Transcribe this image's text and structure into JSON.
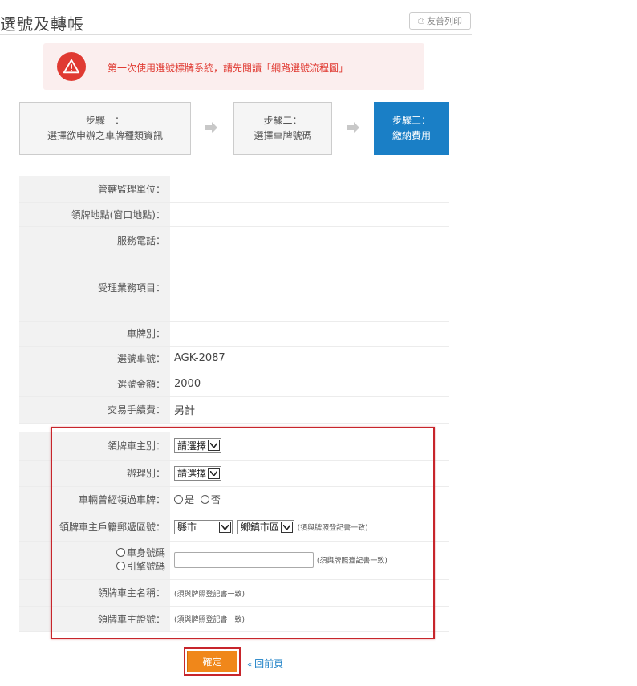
{
  "header": {
    "title": "選號及轉帳",
    "print_label": "友善列印"
  },
  "notice": {
    "text": "第一次使用選號標牌系統，請先閱讀「網路選號流程圖」"
  },
  "steps": [
    {
      "line1": "步驟一：",
      "line2": "選擇欲申辦之車牌種類資訊"
    },
    {
      "line1": "步驟二：",
      "line2": "選擇車牌號碼"
    },
    {
      "line1": "步驟三：",
      "line2": "繳納費用"
    }
  ],
  "info": {
    "supervising_unit_label": "管轄監理單位：",
    "supervising_unit_value": "",
    "location_label": "領牌地點(窗口地點)：",
    "location_value": "",
    "phone_label": "服務電話：",
    "phone_value": "",
    "services_label": "受理業務項目：",
    "services_value": "",
    "plate_type_label": "車牌別：",
    "plate_type_value": "",
    "plate_number_label": "選號車號：",
    "plate_number_value": "AGK-2087",
    "amount_label": "選號金額：",
    "amount_value": "2000",
    "fee_label": "交易手續費：",
    "fee_value": "另計"
  },
  "form": {
    "owner_type_label": "領牌車主別：",
    "owner_type_value": "請選擇",
    "handling_type_label": "辦理別：",
    "handling_type_value": "請選擇",
    "previous_plate_label": "車輛曾經領過車牌：",
    "previous_plate_yes": "是",
    "previous_plate_no": "否",
    "postal_label": "領牌車主戶籍郵遞區號：",
    "county_value": "縣市",
    "district_value": "鄉鎮市區",
    "postal_hint": "(須與牌照登記書一致)",
    "body_number_label": "車身號碼",
    "engine_number_label": "引擎號碼",
    "number_hint": "(須與牌照登記書一致)",
    "owner_name_label": "領牌車主名稱：",
    "owner_name_hint": "(須與牌照登記書一致)",
    "owner_id_label": "領牌車主證號：",
    "owner_id_hint": "(須與牌照登記書一致)"
  },
  "actions": {
    "confirm_label": "確定",
    "back_label": "回前頁"
  }
}
